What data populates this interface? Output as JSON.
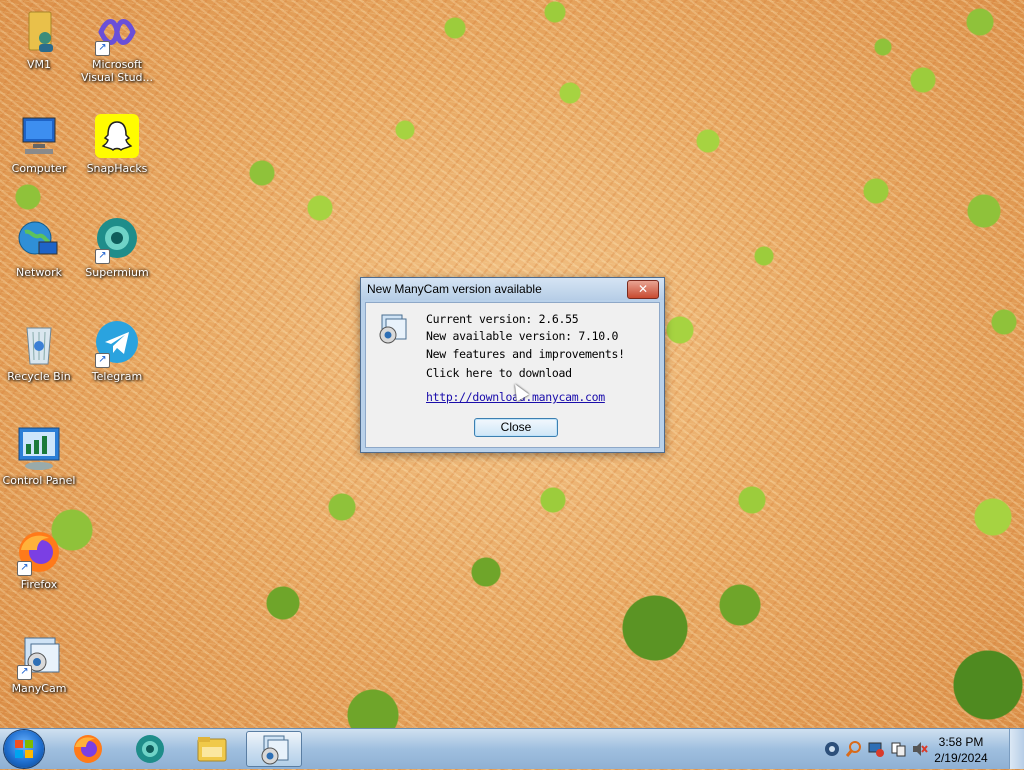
{
  "desktop": {
    "icons": [
      {
        "label": "VM1",
        "icon": "folder-user-icon"
      },
      {
        "label": "Microsoft Visual Stud...",
        "icon": "visual-studio-icon"
      },
      {
        "label": "Computer",
        "icon": "computer-icon"
      },
      {
        "label": "SnapHacks",
        "icon": "snapchat-ghost-icon"
      },
      {
        "label": "Network",
        "icon": "network-globe-icon"
      },
      {
        "label": "Supermium",
        "icon": "supermium-icon"
      },
      {
        "label": "Recycle Bin",
        "icon": "recycle-bin-icon"
      },
      {
        "label": "Telegram",
        "icon": "telegram-icon"
      },
      {
        "label": "Control Panel",
        "icon": "control-panel-icon"
      },
      {
        "label": "Firefox",
        "icon": "firefox-icon"
      },
      {
        "label": "ManyCam",
        "icon": "manycam-icon"
      }
    ]
  },
  "dialog": {
    "title": "New ManyCam version available",
    "lines": [
      "Current version: 2.6.55",
      "New available version: 7.10.0",
      "New features and improvements!",
      "Click here to download"
    ],
    "link": "http://download.manycam.com",
    "close_button": "Close",
    "close_x": "✕"
  },
  "taskbar": {
    "pinned": [
      {
        "name": "firefox-icon"
      },
      {
        "name": "supermium-icon"
      },
      {
        "name": "file-explorer-icon"
      },
      {
        "name": "manycam-icon",
        "active": true
      }
    ],
    "tray_icons": [
      "search-tray-icon",
      "magnifier-icon",
      "network-tray-icon",
      "action-center-icon",
      "volume-muted-icon"
    ],
    "time": "3:58 PM",
    "date": "2/19/2024"
  }
}
